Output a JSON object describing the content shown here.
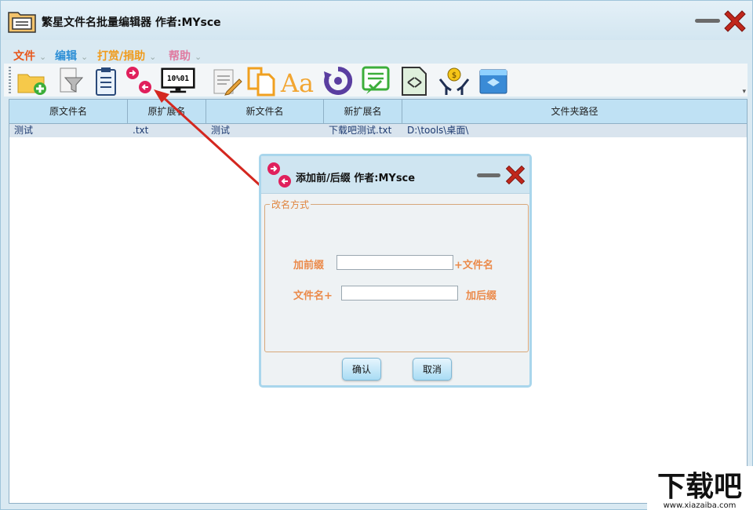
{
  "window": {
    "title": "繁星文件名批量编辑器  作者:MYsce"
  },
  "menu": [
    {
      "label": "文件",
      "color": "#e8561a"
    },
    {
      "label": "编辑",
      "color": "#2d8fd6"
    },
    {
      "label": "打赏/捐助",
      "color": "#f09a1a"
    },
    {
      "label": "帮助",
      "color": "#e07aa0"
    }
  ],
  "toolbar": {
    "icons": [
      "add-folder-icon",
      "filter-document-icon",
      "clipboard-icon",
      "prefix-suffix-icon",
      "binary-monitor-icon",
      "edit-document-icon",
      "copy-pages-icon",
      "font-case-icon",
      "undo-icon",
      "checklist-icon",
      "replace-document-icon",
      "donate-hands-icon",
      "app-window-icon"
    ]
  },
  "table": {
    "headers": [
      "原文件名",
      "原扩展名",
      "新文件名",
      "新扩展名",
      "文件夹路径"
    ],
    "rows": [
      {
        "original_name": "测试",
        "original_ext": ".txt",
        "new_name": "测试",
        "new_ext": "下载吧测试.txt",
        "folder_path": "D:\\tools\\桌面\\"
      }
    ]
  },
  "dialog": {
    "title": "添加前/后缀  作者:MYsce",
    "group_label": "改名方式",
    "prefix_label": "加前缀",
    "prefix_value": "",
    "prefix_tail": "+文件名",
    "suffix_head": "文件名+",
    "suffix_value": "",
    "suffix_label": "加后缀",
    "confirm_label": "确认",
    "cancel_label": "取消"
  },
  "watermark": {
    "brand": "下载吧",
    "url": "www.xiazaiba.com"
  }
}
